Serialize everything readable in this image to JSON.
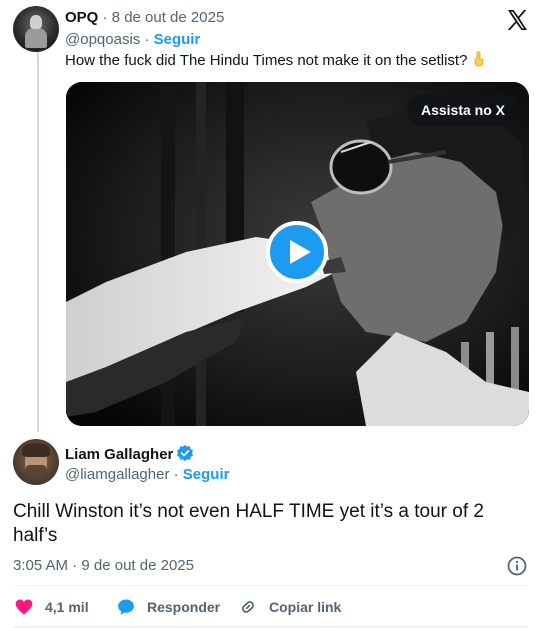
{
  "quoted_tweet": {
    "display_name": "OPQ",
    "date": "· 8 de out de 2025",
    "handle": "@opqoasis ·",
    "follow_label": "Seguir",
    "text": "How the fuck did The Hindu Times not make it on the setlist?",
    "emoji": "pointing-down-hand"
  },
  "video": {
    "watch_label": "Assista no X"
  },
  "reply_tweet": {
    "display_name": "Liam Gallagher",
    "handle": "@liamgallagher ·",
    "follow_label": "Seguir",
    "text": "Chill Winston it’s not even HALF TIME yet it’s a tour of 2 half’s",
    "timestamp": "3:05 AM · 9 de out de 2025"
  },
  "actions": {
    "like_count": "4,1 mil",
    "reply_label": "Responder",
    "copy_label": "Copiar link"
  },
  "colors": {
    "accent": "#1d9bf0",
    "like": "#f91880",
    "text": "#0f1419",
    "muted": "#536471"
  }
}
